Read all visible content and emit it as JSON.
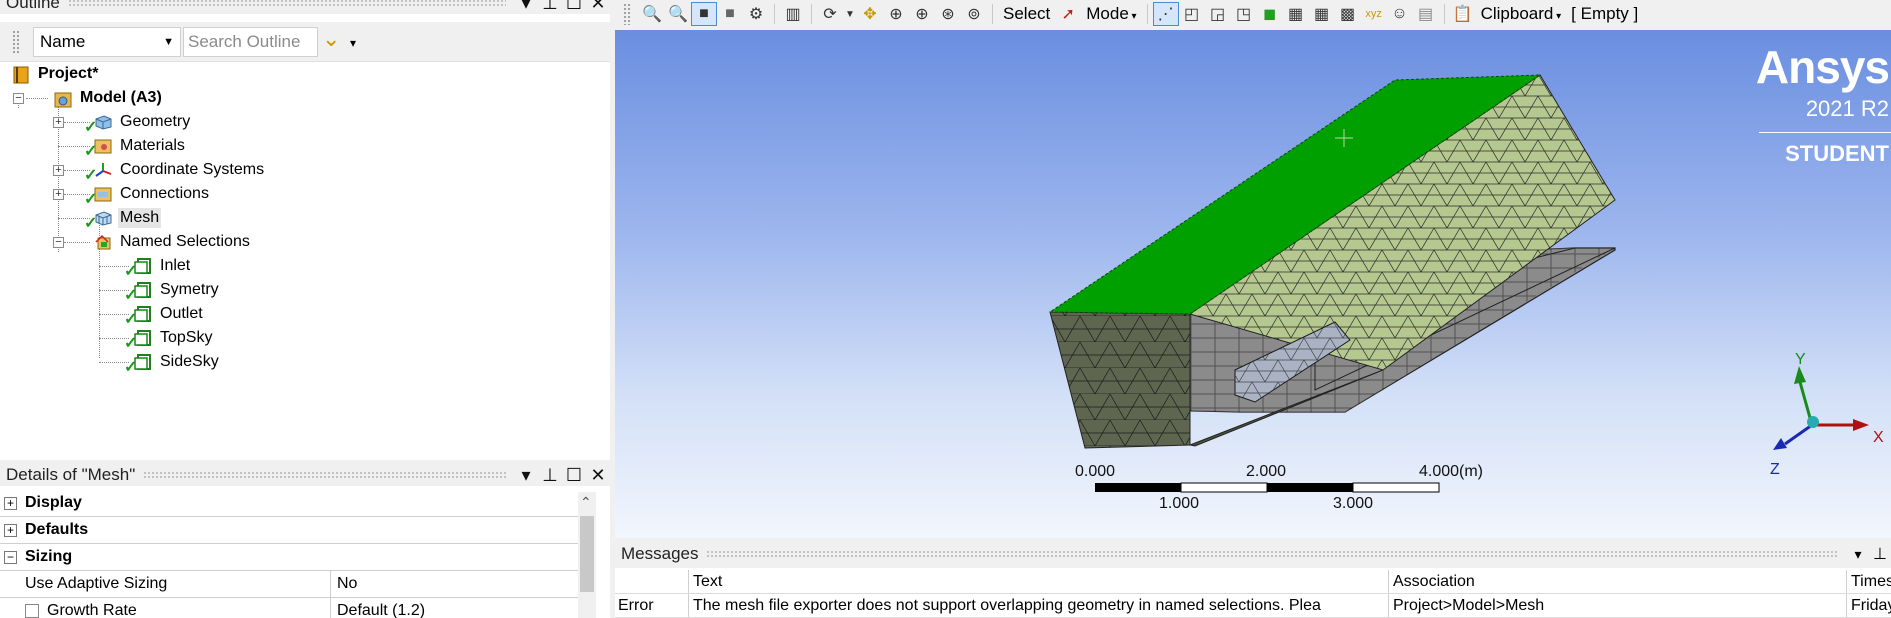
{
  "outline": {
    "title": "Outline",
    "filter_select": "Name",
    "search_placeholder": "Search Outline",
    "tree": [
      {
        "label": "Project*",
        "icon": "project-icon",
        "bold": true
      },
      {
        "label": "Model (A3)",
        "icon": "model-icon",
        "bold": true
      },
      {
        "label": "Geometry",
        "icon": "geometry-icon"
      },
      {
        "label": "Materials",
        "icon": "materials-icon"
      },
      {
        "label": "Coordinate Systems",
        "icon": "coordinate-systems-icon"
      },
      {
        "label": "Connections",
        "icon": "connections-icon"
      },
      {
        "label": "Mesh",
        "icon": "mesh-icon"
      },
      {
        "label": "Named Selections",
        "icon": "named-selections-icon"
      },
      {
        "label": "Inlet",
        "icon": "named-selection-icon"
      },
      {
        "label": "Symetry",
        "icon": "named-selection-icon"
      },
      {
        "label": "Outlet",
        "icon": "named-selection-icon"
      },
      {
        "label": "TopSky",
        "icon": "named-selection-icon"
      },
      {
        "label": "SideSky",
        "icon": "named-selection-icon"
      }
    ]
  },
  "details": {
    "title": "Details of \"Mesh\"",
    "sections": [
      {
        "label": "Display",
        "state": "+"
      },
      {
        "label": "Defaults",
        "state": "+"
      },
      {
        "label": "Sizing",
        "state": "−"
      }
    ],
    "rows": [
      {
        "key": "Use Adaptive Sizing",
        "value": "No"
      },
      {
        "key": "Growth Rate",
        "value": "Default (1.2)"
      }
    ]
  },
  "toolbar": {
    "select_label": "Select",
    "mode_label": "Mode",
    "clipboard_label": "Clipboard",
    "clipboard_state": "[ Empty ]"
  },
  "viewport": {
    "brand": "Ansys",
    "version": "2021 R2",
    "edition": "STUDENT",
    "scale": {
      "top_labels": [
        "0.000",
        "2.000",
        "4.000"
      ],
      "unit": "(m)",
      "bottom_labels": [
        "1.000",
        "3.000"
      ]
    },
    "triad": {
      "x": "X",
      "y": "Y",
      "z": "Z"
    },
    "colors": {
      "selected_face": "#00a000",
      "mesh_face": "#b6c98f",
      "bg_top": "#6a8ee0"
    }
  },
  "messages": {
    "title": "Messages",
    "headers": {
      "type": "",
      "text": "Text",
      "association": "Association",
      "timestamp": "Times"
    },
    "rows": [
      {
        "type": "Error",
        "text": "The mesh file exporter does not support overlapping geometry in named selections.  Plea",
        "association": "Project>Model>Mesh",
        "timestamp": "Friday"
      }
    ]
  }
}
